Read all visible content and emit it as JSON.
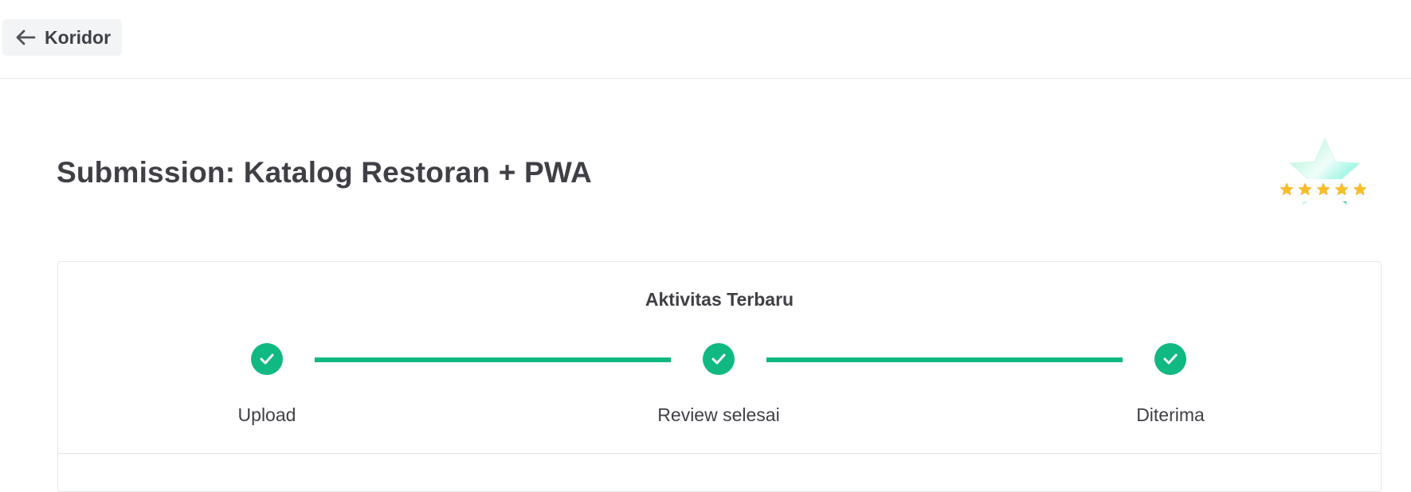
{
  "topbar": {
    "back_label": "Koridor",
    "back_icon": "arrow-left-icon"
  },
  "page": {
    "title": "Submission: Katalog Restoran + PWA",
    "badge_icon": "star-rating-badge-icon",
    "badge_stars": 5
  },
  "activity": {
    "title": "Aktivitas Terbaru",
    "accent_color": "#10b981",
    "steps": [
      {
        "label": "Upload",
        "status": "completed",
        "icon": "check-icon"
      },
      {
        "label": "Review selesai",
        "status": "completed",
        "icon": "check-icon"
      },
      {
        "label": "Diterima",
        "status": "completed",
        "icon": "check-icon"
      }
    ]
  }
}
